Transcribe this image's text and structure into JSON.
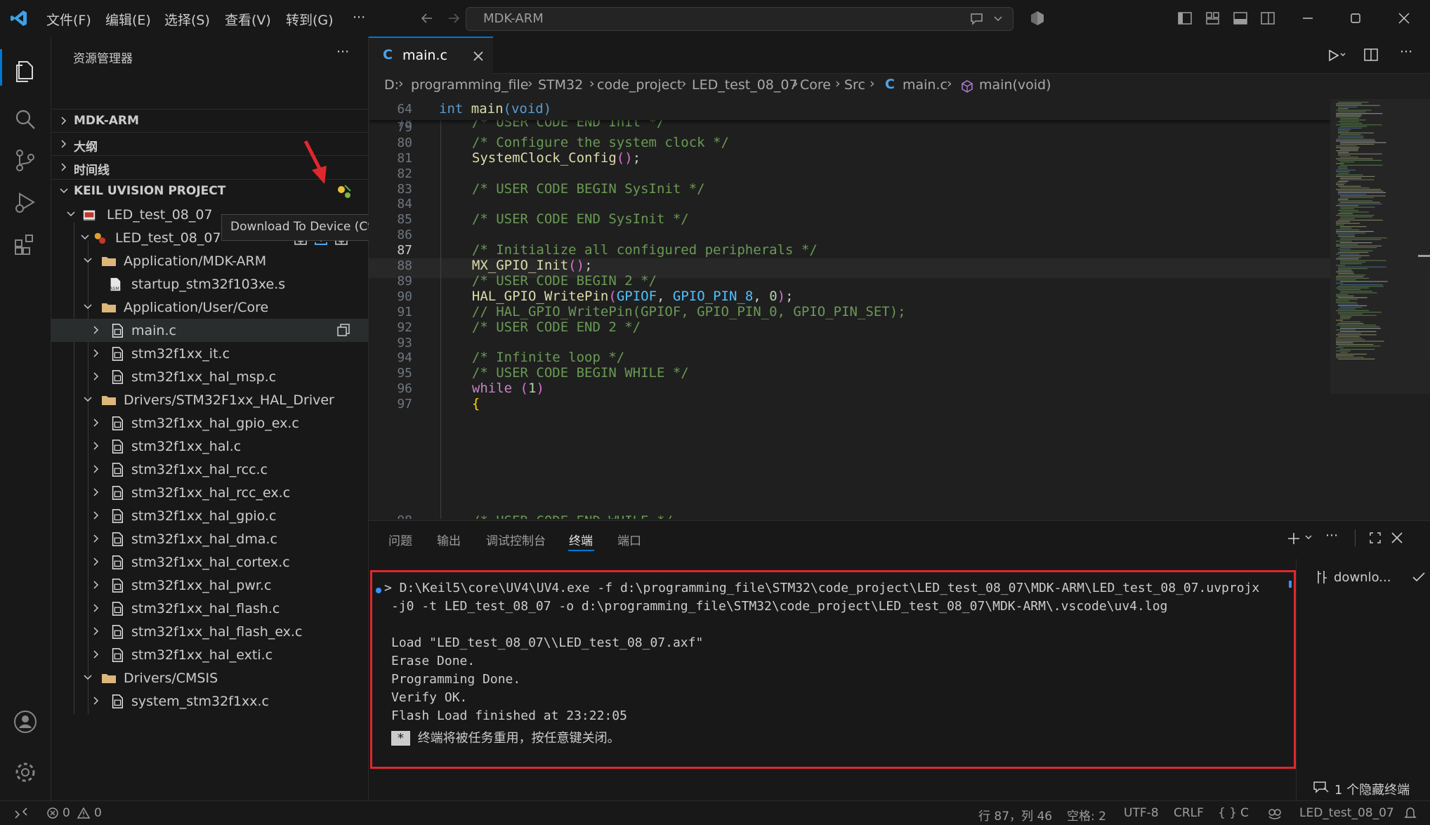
{
  "titlebar": {
    "menus": [
      "文件(F)",
      "编辑(E)",
      "选择(S)",
      "查看(V)",
      "转到(G)",
      "···"
    ],
    "search_text": "MDK-ARM"
  },
  "sidebar": {
    "title": "资源管理器",
    "more": "···",
    "sections": [
      "MDK-ARM",
      "大纲",
      "时间线",
      "KEIL UVISION PROJECT"
    ],
    "tree": [
      {
        "label": "LED_test_08_07"
      },
      {
        "label": "LED_test_08_07"
      },
      {
        "label": "Application/MDK-ARM"
      },
      {
        "label": "startup_stm32f103xe.s"
      },
      {
        "label": "Application/User/Core"
      },
      {
        "label": "main.c"
      },
      {
        "label": "stm32f1xx_it.c"
      },
      {
        "label": "stm32f1xx_hal_msp.c"
      },
      {
        "label": "Drivers/STM32F1xx_HAL_Driver"
      },
      {
        "label": "stm32f1xx_hal_gpio_ex.c"
      },
      {
        "label": "stm32f1xx_hal.c"
      },
      {
        "label": "stm32f1xx_hal_rcc.c"
      },
      {
        "label": "stm32f1xx_hal_rcc_ex.c"
      },
      {
        "label": "stm32f1xx_hal_gpio.c"
      },
      {
        "label": "stm32f1xx_hal_dma.c"
      },
      {
        "label": "stm32f1xx_hal_cortex.c"
      },
      {
        "label": "stm32f1xx_hal_pwr.c"
      },
      {
        "label": "stm32f1xx_hal_flash.c"
      },
      {
        "label": "stm32f1xx_hal_flash_ex.c"
      },
      {
        "label": "stm32f1xx_hal_exti.c"
      },
      {
        "label": "Drivers/CMSIS"
      },
      {
        "label": "system_stm32f1xx.c"
      }
    ],
    "tooltip": "Download To Device (Ctrl+Alt+D)"
  },
  "editor": {
    "tab": {
      "icon": "C",
      "label": "main.c"
    },
    "breadcrumbs": [
      "D:",
      "programming_file",
      "STM32",
      "code_project",
      "LED_test_08_07",
      "Core",
      "Src",
      "main.c",
      "main(void)"
    ],
    "breadcrumb_icon": "C",
    "sticky": {
      "line": "64",
      "kw": "int",
      "fn": "main",
      "rest": "(void)"
    },
    "partial_top": "  /* USER CODE END Init */",
    "lines": [
      {
        "n": "79",
        "text": ""
      },
      {
        "n": "80",
        "text": "  /* Configure the system clock */"
      },
      {
        "n": "81",
        "text": "  SystemClock_Config();"
      },
      {
        "n": "82",
        "text": ""
      },
      {
        "n": "83",
        "text": "  /* USER CODE BEGIN SysInit */"
      },
      {
        "n": "84",
        "text": ""
      },
      {
        "n": "85",
        "text": "  /* USER CODE END SysInit */"
      },
      {
        "n": "86",
        "text": ""
      },
      {
        "n": "87",
        "text": "  /* Initialize all configured peripherals */"
      },
      {
        "n": "88",
        "text": "  MX_GPIO_Init();"
      },
      {
        "n": "89",
        "text": "  /* USER CODE BEGIN 2 */"
      },
      {
        "n": "90",
        "text": "  HAL_GPIO_WritePin(GPIOF, GPIO_PIN_8, 0);"
      },
      {
        "n": "91",
        "text": "  // HAL_GPIO_WritePin(GPIOF, GPIO_PIN_0, GPIO_PIN_SET);"
      },
      {
        "n": "92",
        "text": "  /* USER CODE END 2 */"
      },
      {
        "n": "93",
        "text": ""
      },
      {
        "n": "94",
        "text": "  /* Infinite loop */"
      },
      {
        "n": "95",
        "text": "  /* USER CODE BEGIN WHILE */"
      },
      {
        "n": "96",
        "text": "  while (1)"
      },
      {
        "n": "97",
        "text": "  {"
      }
    ]
  },
  "panel": {
    "tabs": [
      "问题",
      "输出",
      "调试控制台",
      "终端",
      "端口"
    ],
    "active_tab": "终端",
    "task_label": "downlo...",
    "hidden_terminals": "1 个隐藏终端",
    "terminal_lines": [
      "> D:\\Keil5\\core\\UV4\\UV4.exe -f d:\\programming_file\\STM32\\code_project\\LED_test_08_07\\MDK-ARM\\LED_test_08_07.uvprojx",
      "-j0 -t LED_test_08_07 -o d:\\programming_file\\STM32\\code_project\\LED_test_08_07\\MDK-ARM\\.vscode\\uv4.log",
      "",
      "Load \"LED_test_08_07\\\\LED_test_08_07.axf\"",
      "Erase Done.",
      "Programming Done.",
      "Verify OK.",
      "Flash Load finished at 23:22:05"
    ],
    "close_prompt": "终端将被任务重用，按任意键关闭。",
    "close_prompt_marker": "*"
  },
  "statusbar": {
    "errors": "0",
    "warnings": "0",
    "position": "行 87，列 46",
    "spaces": "空格: 2",
    "encoding": "UTF-8",
    "eol": "CRLF",
    "language": "C",
    "project": "LED_test_08_07"
  },
  "colors": {
    "accent": "#0078d4",
    "highlight_box": "#e0272e",
    "annotation_arrow": "#e0272e"
  }
}
